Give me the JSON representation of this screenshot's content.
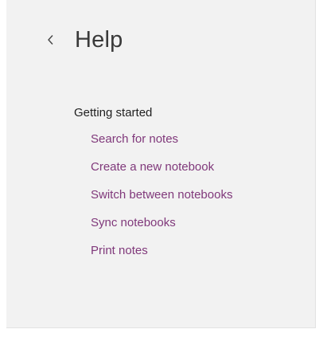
{
  "header": {
    "back_icon": "chevron-left-icon",
    "title": "Help"
  },
  "section": {
    "heading": "Getting started",
    "topics": [
      {
        "label": "Search for notes"
      },
      {
        "label": "Create a new notebook"
      },
      {
        "label": "Switch between notebooks"
      },
      {
        "label": "Sync notebooks"
      },
      {
        "label": "Print notes"
      }
    ]
  },
  "colors": {
    "panel_background": "#f2f2f2",
    "link": "#80397b",
    "title": "#3a3a3a"
  }
}
